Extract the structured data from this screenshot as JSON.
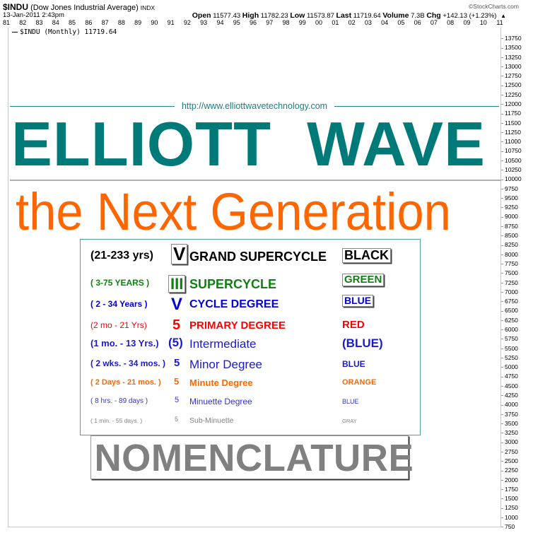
{
  "header": {
    "symbol": "$INDU",
    "name": "(Dow Jones Industrial Average)",
    "exchange": "INDX",
    "datetime": "13-Jan-2011 2:43pm",
    "credit": "©StockCharts.com",
    "quote": {
      "open_label": "Open",
      "open": "11577.43",
      "high_label": "High",
      "high": "11782.23",
      "low_label": "Low",
      "low": "11573.87",
      "last_label": "Last",
      "last": "11719.64",
      "volume_label": "Volume",
      "volume": "7.3B",
      "chg_label": "Chg",
      "chg": "+142.13 (+1.23%)",
      "direction_icon": "up-arrow-icon",
      "direction_glyph": "▲"
    }
  },
  "legend": {
    "label": "$INDU (Monthly) 11719.64"
  },
  "chart_data": {
    "type": "line",
    "title": "$INDU (Dow Jones Industrial Average) INDX",
    "series": [
      {
        "name": "$INDU (Monthly)",
        "last_value": 11719.64,
        "values": []
      }
    ],
    "x_tick_labels": [
      "81",
      "82",
      "83",
      "84",
      "85",
      "86",
      "87",
      "88",
      "89",
      "90",
      "91",
      "92",
      "93",
      "94",
      "95",
      "96",
      "97",
      "98",
      "99",
      "00",
      "01",
      "02",
      "03",
      "04",
      "05",
      "06",
      "07",
      "08",
      "09",
      "10",
      "11"
    ],
    "y_tick_labels": [
      "13750",
      "13500",
      "13250",
      "13000",
      "12750",
      "12500",
      "12250",
      "12000",
      "11750",
      "11500",
      "11250",
      "11000",
      "10750",
      "10500",
      "10250",
      "10000",
      "9750",
      "9500",
      "9250",
      "9000",
      "8750",
      "8500",
      "8250",
      "8000",
      "7750",
      "7500",
      "7250",
      "7000",
      "6750",
      "6500",
      "6250",
      "6000",
      "5750",
      "5500",
      "5250",
      "5000",
      "4750",
      "4500",
      "4250",
      "4000",
      "3750",
      "3500",
      "3250",
      "3000",
      "2750",
      "2500",
      "2250",
      "2000",
      "1750",
      "1500",
      "1250",
      "1000",
      "750"
    ],
    "ylim": [
      750,
      13750
    ],
    "y_axis_side": "right",
    "xlabel": "",
    "ylabel": "",
    "grid": false,
    "legend_position": "top-left"
  },
  "overlay": {
    "url": "http://www.elliottwavetechnology.com",
    "title": "ELLIOTT  WAVE",
    "subtitle": "the Next Generation",
    "footer": "NOMENCLATURE",
    "colors": {
      "teal": "#007a78",
      "orange": "#ff6600",
      "gray": "#808080"
    }
  },
  "nomenclature": [
    {
      "range": "(21-233 yrs)",
      "label": "V",
      "degree": "GRAND SUPERCYCLE",
      "color_name": "BLACK",
      "color": "#000000"
    },
    {
      "range": "( 3-75 YEARS )",
      "label": "III",
      "degree": "SUPERCYCLE",
      "color_name": "GREEN",
      "color": "#108010"
    },
    {
      "range": "( 2 - 34 Years )",
      "label": "V",
      "degree": "CYCLE DEGREE",
      "color_name": "BLUE",
      "color": "#0000e0"
    },
    {
      "range": "(2 mo - 21 Yrs)",
      "label": "5",
      "degree": "PRIMARY DEGREE",
      "color_name": "RED",
      "color": "#ff0000"
    },
    {
      "range": "(1 mo. - 13 Yrs.)",
      "label": "(5)",
      "degree": "Intermediate",
      "color_name": "(BLUE)",
      "color": "#1a1ad0"
    },
    {
      "range": "( 2 wks. - 34 mos. )",
      "label": "5",
      "degree": "Minor Degree",
      "color_name": "BLUE",
      "color": "#1a1ad0"
    },
    {
      "range": "( 2 Days - 21 mos. )",
      "label": "5",
      "degree": "Minute Degree",
      "color_name": "ORANGE",
      "color": "#ff6600"
    },
    {
      "range": "( 8 hrs. - 89 days )",
      "label": "5",
      "degree": "Minuette Degree",
      "color_name": "BLUE",
      "color": "#3333cc"
    },
    {
      "range": "( 1 min. - 55 days. )",
      "label": "5",
      "degree": "Sub-Minuette",
      "color_name": "GRAY",
      "color": "#808080"
    }
  ]
}
